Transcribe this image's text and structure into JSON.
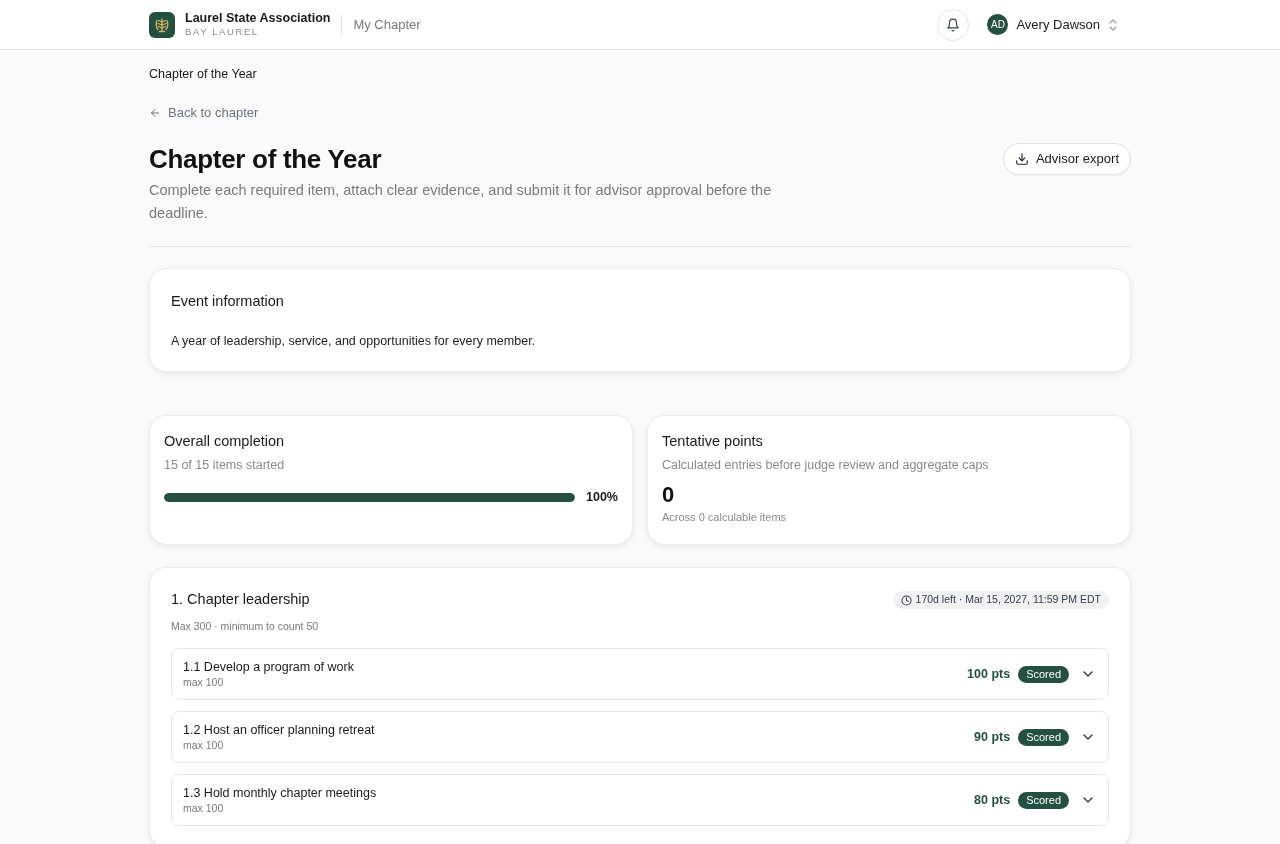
{
  "header": {
    "brand": {
      "name": "Laurel State Association",
      "subtitle": "BAY LAUREL"
    },
    "nav_link": "My Chapter",
    "user": {
      "initials": "AD",
      "name": "Avery Dawson"
    }
  },
  "breadcrumb": "Chapter of the Year",
  "back_link": "Back to chapter",
  "page": {
    "title": "Chapter of the Year",
    "description": "Complete each required item, attach clear evidence, and submit it for advisor approval before the deadline.",
    "export_button": "Advisor export"
  },
  "event_information": {
    "title": "Event information",
    "text": "A year of leadership, service, and opportunities for every member."
  },
  "overall_completion": {
    "title": "Overall completion",
    "subtitle": "15 of 15 items started",
    "level": 1,
    "reading": "100%"
  },
  "tentative_points": {
    "title": "Tentative points",
    "subtitle": "Calculated entries before judge review and aggregate caps",
    "value": "0",
    "note": "Across 0 calculable items"
  },
  "sections": [
    {
      "title": "1. Chapter leadership",
      "meta": "Max 300 · minimum to count 50",
      "deadline": "170d left · Mar 15, 2027, 11:59 PM EDT",
      "items": [
        {
          "title": "1.1 Develop a program of work",
          "max": "max 100",
          "points": "100 pts",
          "status": "Scored",
          "expanded": false
        },
        {
          "title": "1.2 Host an officer planning retreat",
          "max": "max 100",
          "points": "90 pts",
          "status": "Scored",
          "expanded": false
        },
        {
          "title": "1.3 Hold monthly chapter meetings",
          "max": "max 100",
          "points": "80 pts",
          "status": "Scored",
          "expanded": false
        }
      ]
    }
  ]
}
